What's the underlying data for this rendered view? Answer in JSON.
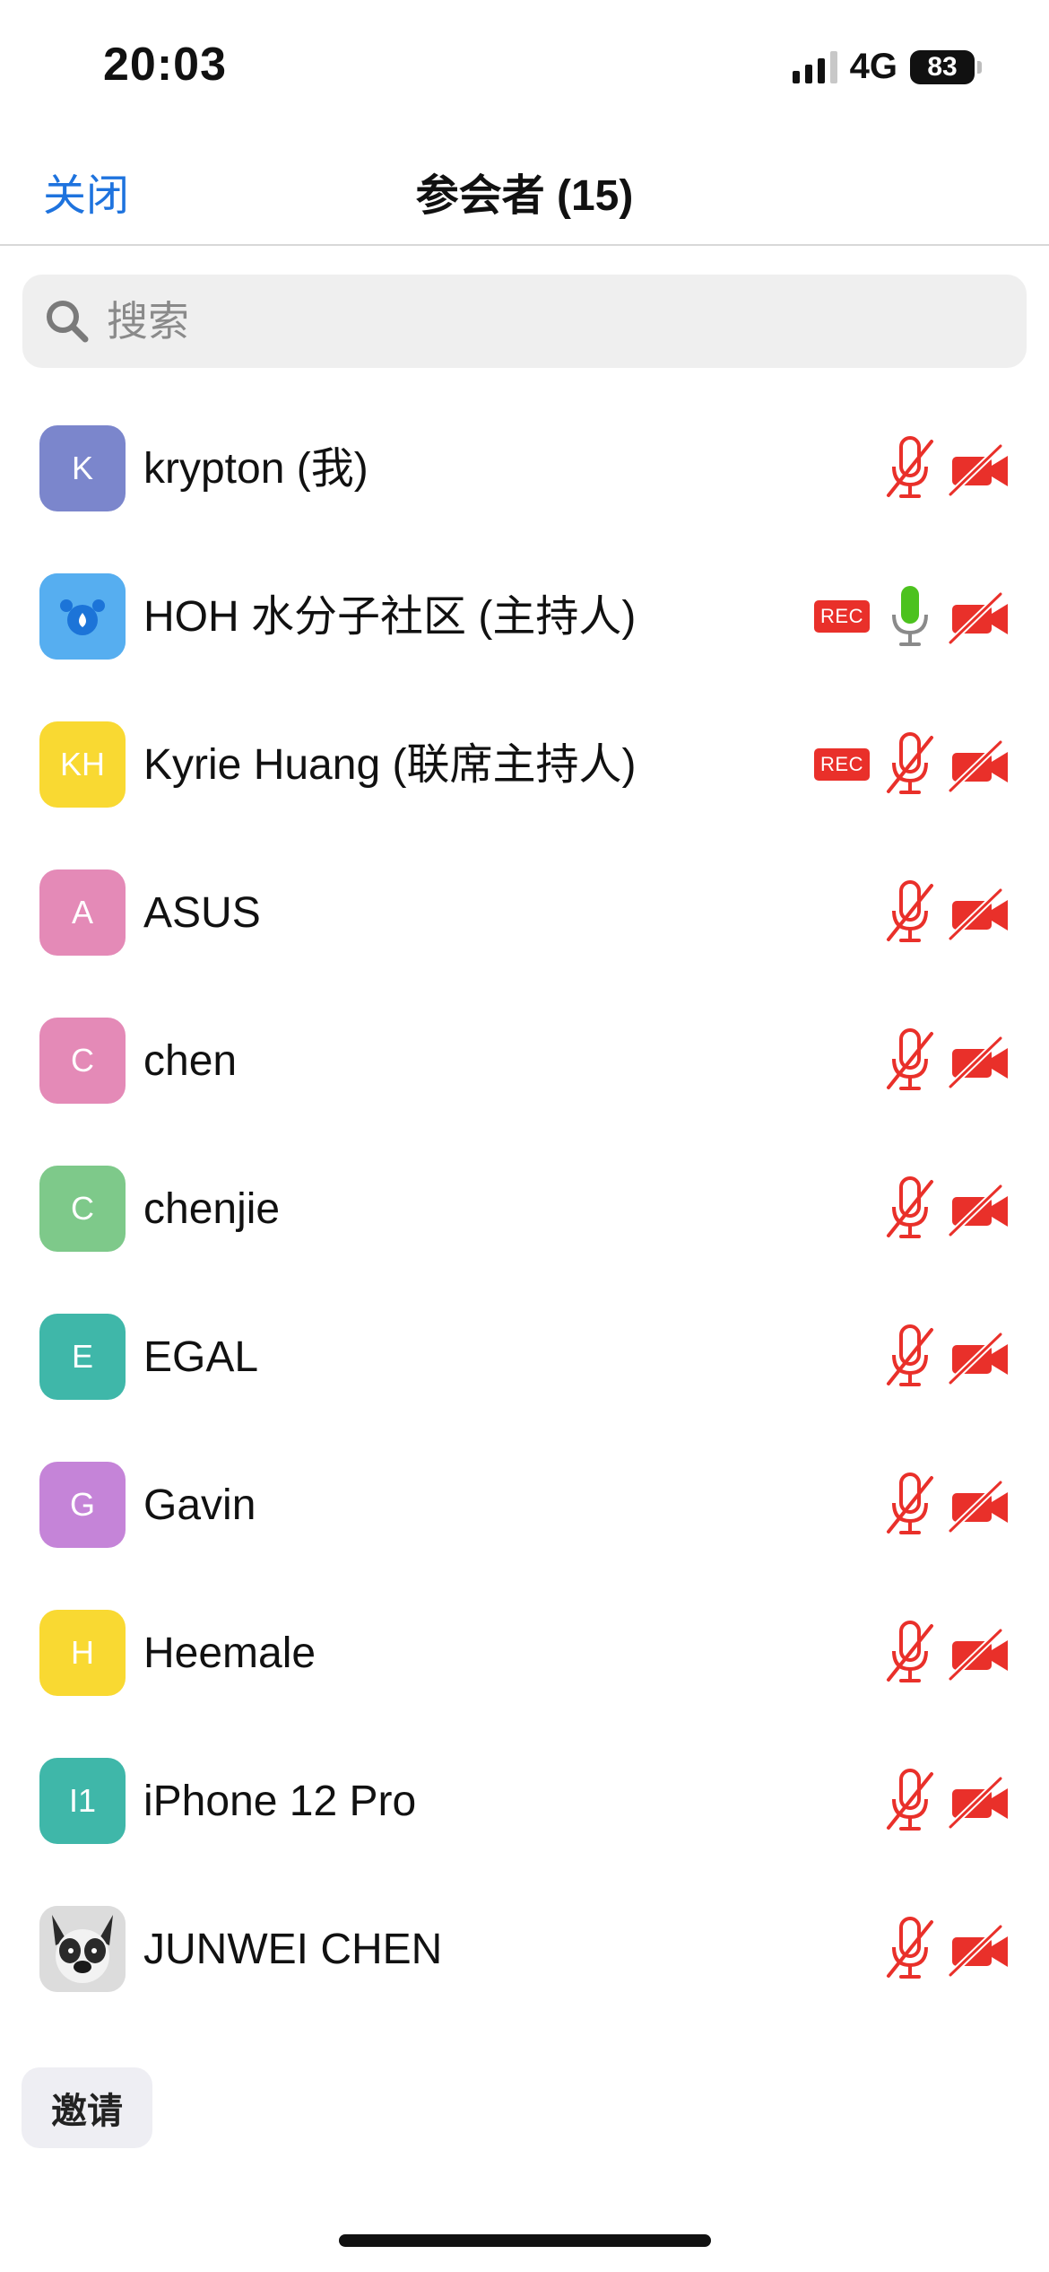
{
  "status_bar": {
    "time": "20:03",
    "network": "4G",
    "battery": "83",
    "signal_bars_active": 3,
    "signal_bars_total": 4
  },
  "nav": {
    "close_label": "关闭",
    "title": "参会者 (15)"
  },
  "search": {
    "placeholder": "搜索",
    "value": ""
  },
  "colors": {
    "accent": "#1e73de",
    "muted_red": "#e9302a",
    "mic_active_green": "#4cc21e"
  },
  "participants": [
    {
      "name": "krypton (我)",
      "initials": "K",
      "avatar_color": "#7b86cc",
      "avatar_type": "initials",
      "rec": false,
      "mic": "muted",
      "camera": "off"
    },
    {
      "name": "HOH 水分子社区 (主持人)",
      "initials": "",
      "avatar_color": "#56aef0",
      "avatar_type": "logo",
      "rec": true,
      "rec_label": "REC",
      "mic": "active",
      "camera": "off"
    },
    {
      "name": "Kyrie Huang (联席主持人)",
      "initials": "KH",
      "avatar_color": "#f9d932",
      "avatar_type": "initials",
      "rec": true,
      "rec_label": "REC",
      "mic": "muted",
      "camera": "off"
    },
    {
      "name": "ASUS",
      "initials": "A",
      "avatar_color": "#e48ab7",
      "avatar_type": "initials",
      "rec": false,
      "mic": "muted",
      "camera": "off"
    },
    {
      "name": "chen",
      "initials": "C",
      "avatar_color": "#e48ab7",
      "avatar_type": "initials",
      "rec": false,
      "mic": "muted",
      "camera": "off"
    },
    {
      "name": "chenjie",
      "initials": "C",
      "avatar_color": "#7ec98a",
      "avatar_type": "initials",
      "rec": false,
      "mic": "muted",
      "camera": "off"
    },
    {
      "name": "EGAL",
      "initials": "E",
      "avatar_color": "#3fb7a9",
      "avatar_type": "initials",
      "rec": false,
      "mic": "muted",
      "camera": "off"
    },
    {
      "name": "Gavin",
      "initials": "G",
      "avatar_color": "#c584d8",
      "avatar_type": "initials",
      "rec": false,
      "mic": "muted",
      "camera": "off"
    },
    {
      "name": "Heemale",
      "initials": "H",
      "avatar_color": "#f9d932",
      "avatar_type": "initials",
      "rec": false,
      "mic": "muted",
      "camera": "off"
    },
    {
      "name": "iPhone 12 Pro",
      "initials": "I1",
      "avatar_color": "#3fb7a9",
      "avatar_type": "initials",
      "rec": false,
      "mic": "muted",
      "camera": "off"
    },
    {
      "name": "JUNWEI CHEN",
      "initials": "",
      "avatar_color": "#d9d9d9",
      "avatar_type": "photo",
      "rec": false,
      "mic": "muted",
      "camera": "off"
    }
  ],
  "invite_label": "邀请"
}
